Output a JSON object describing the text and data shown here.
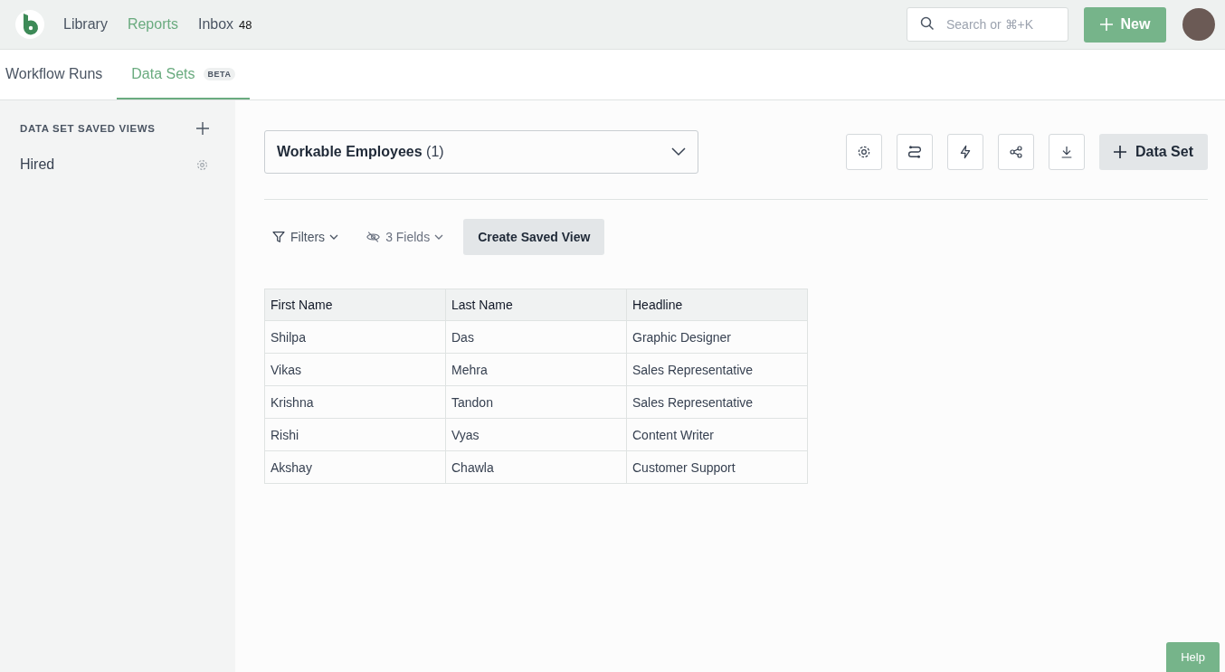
{
  "nav": [
    {
      "label": "Library",
      "selected": false
    },
    {
      "label": "Reports",
      "selected": true
    },
    {
      "label": "Inbox",
      "selected": false,
      "badge": "48"
    }
  ],
  "search": {
    "placeholder": "Search or ⌘+K"
  },
  "new_button": {
    "label": "New"
  },
  "tabs": [
    {
      "label": "Workflow Runs",
      "selected": false
    },
    {
      "label": "Data Sets",
      "selected": true,
      "badge": "BETA"
    }
  ],
  "sidebar": {
    "heading": "DATA SET SAVED VIEWS",
    "items": [
      {
        "label": "Hired"
      }
    ]
  },
  "dataset_select": {
    "value": "Workable Employees",
    "count": "(1)"
  },
  "toolbar": {
    "add_button": "Data Set"
  },
  "filters": {
    "filters_label": "Filters",
    "fields_label": "3 Fields",
    "save_button": "Create Saved View"
  },
  "table": {
    "columns": [
      "First Name",
      "Last Name",
      "Headline"
    ],
    "rows": [
      [
        "Shilpa",
        "Das",
        "Graphic Designer"
      ],
      [
        "Vikas",
        "Mehra",
        "Sales Representative"
      ],
      [
        "Krishna",
        "Tandon",
        "Sales Representative"
      ],
      [
        "Rishi",
        "Vyas",
        "Content Writer"
      ],
      [
        "Akshay",
        "Chawla",
        "Customer Support"
      ]
    ]
  },
  "help_button": "Help"
}
